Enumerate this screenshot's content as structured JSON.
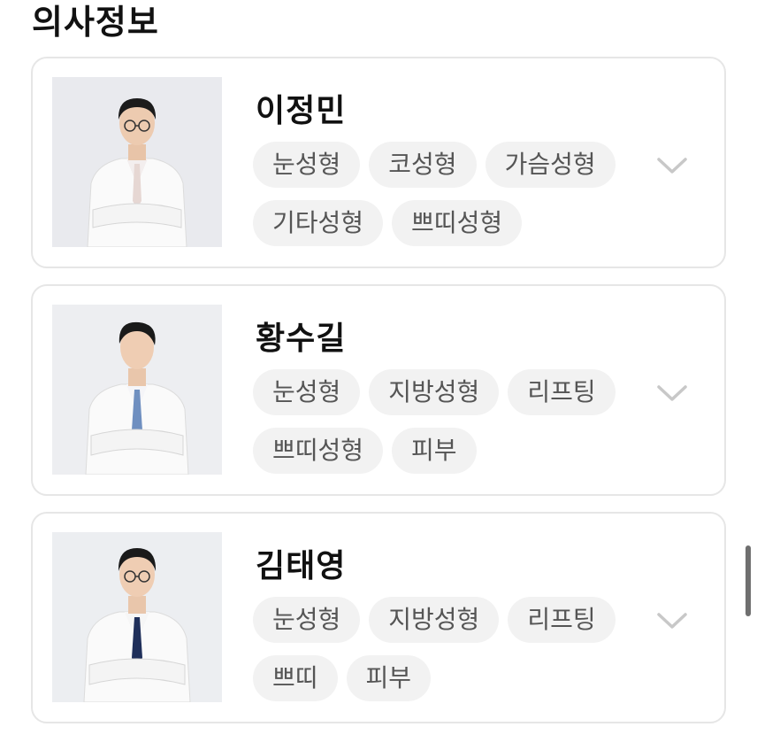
{
  "section": {
    "title": "의사정보"
  },
  "doctors": [
    {
      "name": "이정민",
      "tags": [
        "눈성형",
        "코성형",
        "가슴성형",
        "기타성형",
        "쁘띠성형"
      ],
      "expand_icon": "chevron-down-icon",
      "tie_color": "#e6d7d3"
    },
    {
      "name": "황수길",
      "tags": [
        "눈성형",
        "지방성형",
        "리프팅",
        "쁘띠성형",
        "피부"
      ],
      "expand_icon": "chevron-down-icon",
      "tie_color": "#6f8fc0"
    },
    {
      "name": "김태영",
      "tags": [
        "눈성형",
        "지방성형",
        "리프팅",
        "쁘띠",
        "피부"
      ],
      "expand_icon": "chevron-down-icon",
      "tie_color": "#1f2f5a"
    }
  ],
  "colors": {
    "card_border": "#e6e6e6",
    "tag_background": "#f2f2f2",
    "tag_text": "#555555",
    "chevron": "#c8c8c8"
  }
}
